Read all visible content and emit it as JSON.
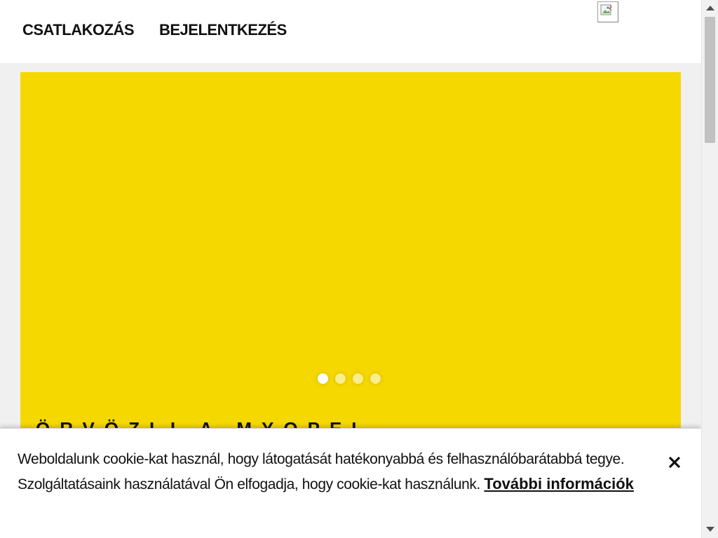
{
  "header": {
    "nav": {
      "join_label": "CSATLAKOZÁS",
      "login_label": "BEJELENTKEZÉS"
    },
    "broken_image_icon": "broken-image-icon"
  },
  "hero": {
    "background_color": "#f5d800",
    "slide_dots": {
      "count": 4,
      "active_index": 0
    },
    "title_partial": "ÖRVÖZLI A MYOPEL"
  },
  "cookie_banner": {
    "message": "Weboldalunk cookie-kat használ, hogy látogatását hatékonyabbá és felhasználóbarátabbá tegye. Szolgáltatásaink használatával Ön elfogadja, hogy cookie-kat használunk.",
    "link_label": "További információk",
    "close_icon": "close-icon"
  }
}
